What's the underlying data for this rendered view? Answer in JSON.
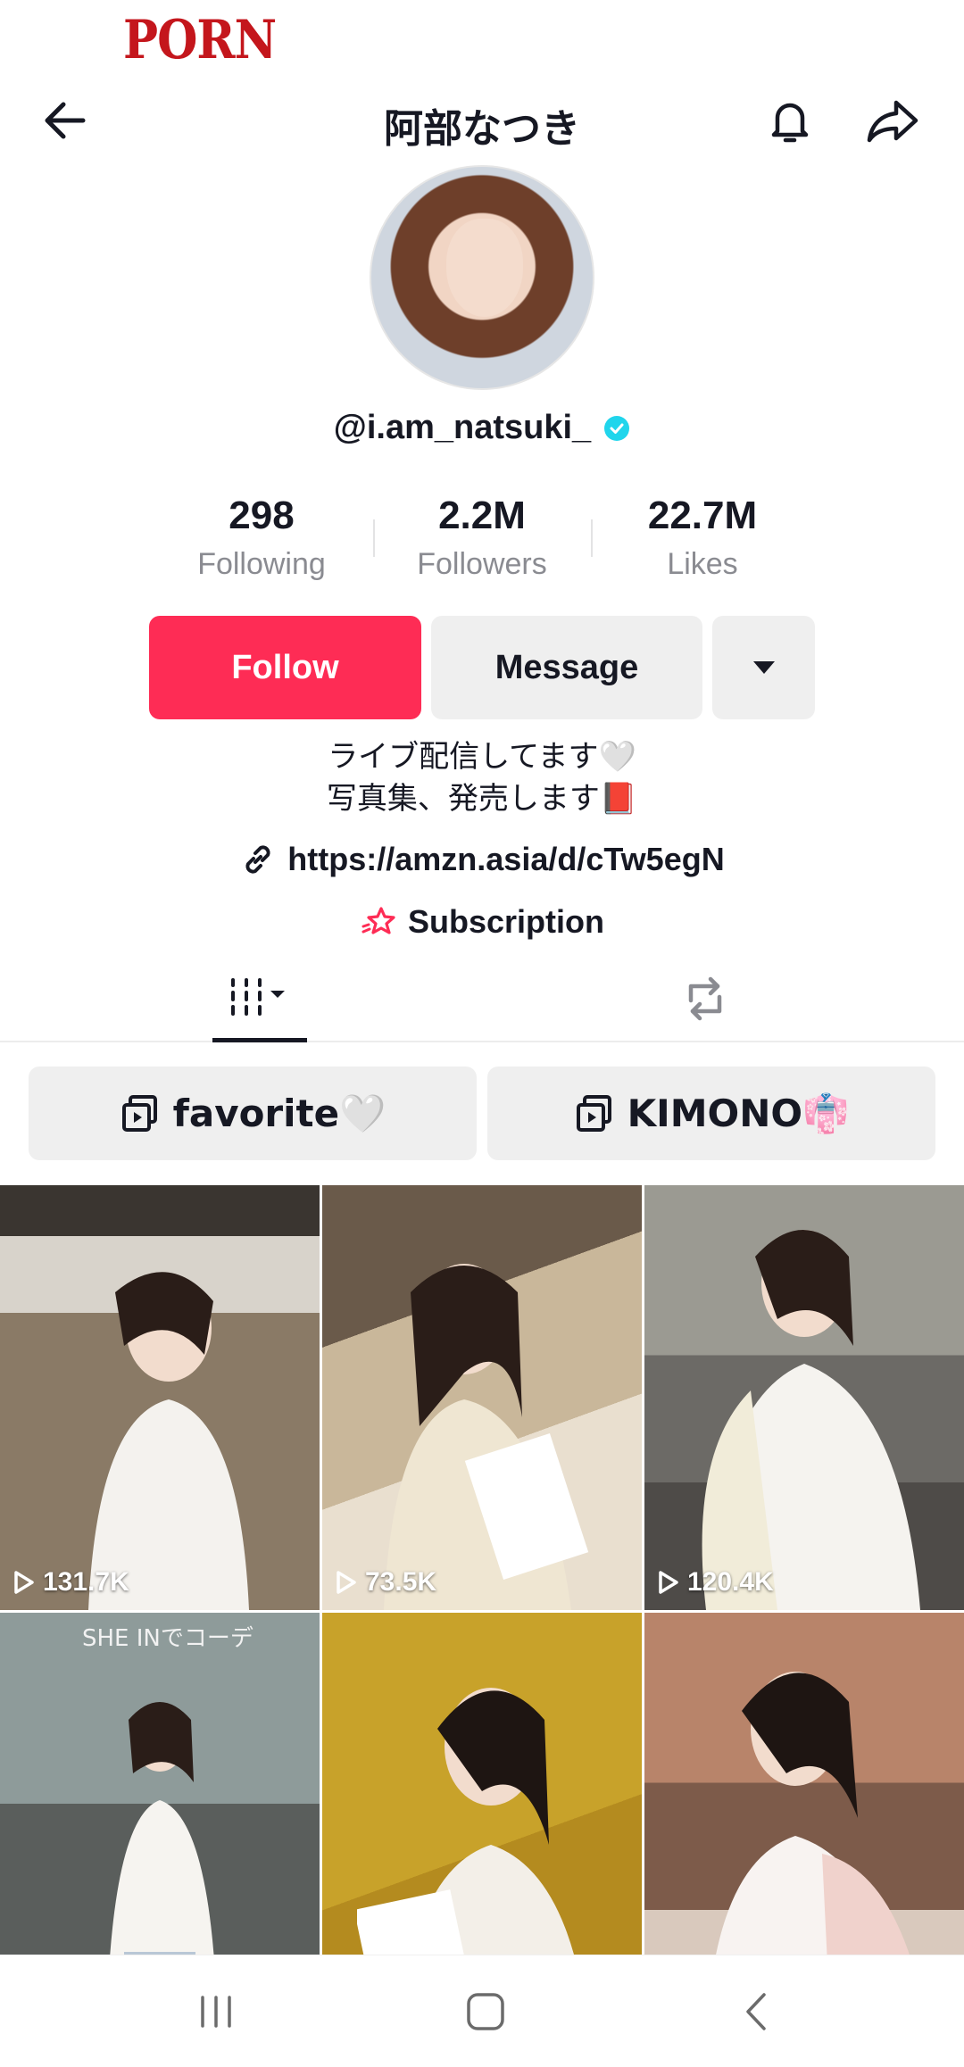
{
  "watermark": {
    "text": "PORN"
  },
  "header": {
    "title": "阿部なつき"
  },
  "profile": {
    "username": "@i.am_natsuki_",
    "verified": true,
    "stats": [
      {
        "value": "298",
        "label": "Following"
      },
      {
        "value": "2.2M",
        "label": "Followers"
      },
      {
        "value": "22.7M",
        "label": "Likes"
      }
    ],
    "buttons": {
      "follow": "Follow",
      "message": "Message"
    },
    "bio_line1": "ライブ配信してます🤍",
    "bio_line2": "写真集、発売します📕",
    "link": "https://amzn.asia/d/cTw5egN",
    "subscription": "Subscription"
  },
  "playlists": [
    {
      "label": "favorite🤍"
    },
    {
      "label": "KIMONO👘"
    }
  ],
  "videos": [
    {
      "views": "131.7K"
    },
    {
      "views": "73.5K"
    },
    {
      "views": "120.4K"
    },
    {
      "caption": "SHE INでコーデ"
    },
    {},
    {}
  ],
  "colors": {
    "accent": "#fe2c55",
    "verified": "#20d5ec",
    "text": "#161823",
    "muted": "#8a8b91"
  }
}
